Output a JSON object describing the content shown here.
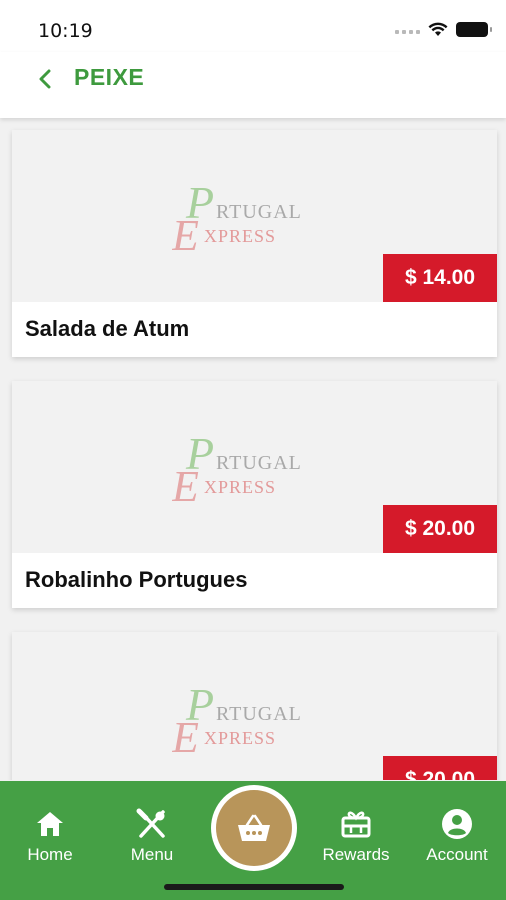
{
  "status_bar": {
    "time": "10:19"
  },
  "header": {
    "title": "PEIXE"
  },
  "logo": {
    "word1_initial": "P",
    "word1_rest": "RTUGAL",
    "word2_initial": "E",
    "word2_rest": "XPRESS"
  },
  "products": [
    {
      "name": "Salada de Atum",
      "price": "$ 14.00"
    },
    {
      "name": "Robalinho Portugues",
      "price": "$ 20.00"
    },
    {
      "name": "",
      "price": "$ 20.00"
    }
  ],
  "tabs": {
    "home": "Home",
    "menu": "Menu",
    "rewards": "Rewards",
    "account": "Account"
  },
  "colors": {
    "accent_green": "#45a045",
    "title_green": "#3e9a3e",
    "price_red": "#d51a2a",
    "cart_gold": "#b8955a"
  },
  "icons": [
    "chevron-left-icon",
    "home-icon",
    "fork-knife-icon",
    "basket-icon",
    "gift-icon",
    "account-icon",
    "wifi-icon",
    "battery-icon",
    "signal-icon"
  ]
}
